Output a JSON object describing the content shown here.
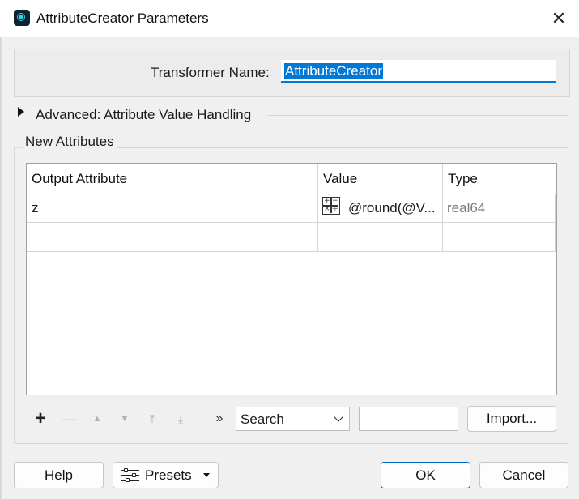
{
  "window": {
    "title": "AttributeCreator Parameters",
    "icon": "fme-app-icon",
    "close_icon": "close-icon"
  },
  "transformer": {
    "label": "Transformer Name:",
    "value": "AttributeCreator"
  },
  "advanced": {
    "label": "Advanced: Attribute Value Handling",
    "expanded": false
  },
  "new_attributes": {
    "group_label": "New Attributes",
    "columns": [
      "Output Attribute",
      "Value",
      "Type"
    ],
    "rows": [
      {
        "output": "z",
        "value": "@round(@V...",
        "type": "real64",
        "value_icon": "arithmetic-editor-icon"
      },
      {
        "output": "",
        "value": "",
        "type": ""
      }
    ]
  },
  "toolbar": {
    "add": "+",
    "remove": "—",
    "move_up": "▲",
    "move_down": "▼",
    "move_top": "⤒",
    "move_bottom": "⤓",
    "more": "»",
    "search_select": "Search",
    "search_text": "",
    "import": "Import..."
  },
  "footer": {
    "help": "Help",
    "presets": "Presets",
    "ok": "OK",
    "cancel": "Cancel"
  },
  "colors": {
    "accent": "#0078d4",
    "selection": "#0078d4",
    "background": "#f0f0f0"
  }
}
